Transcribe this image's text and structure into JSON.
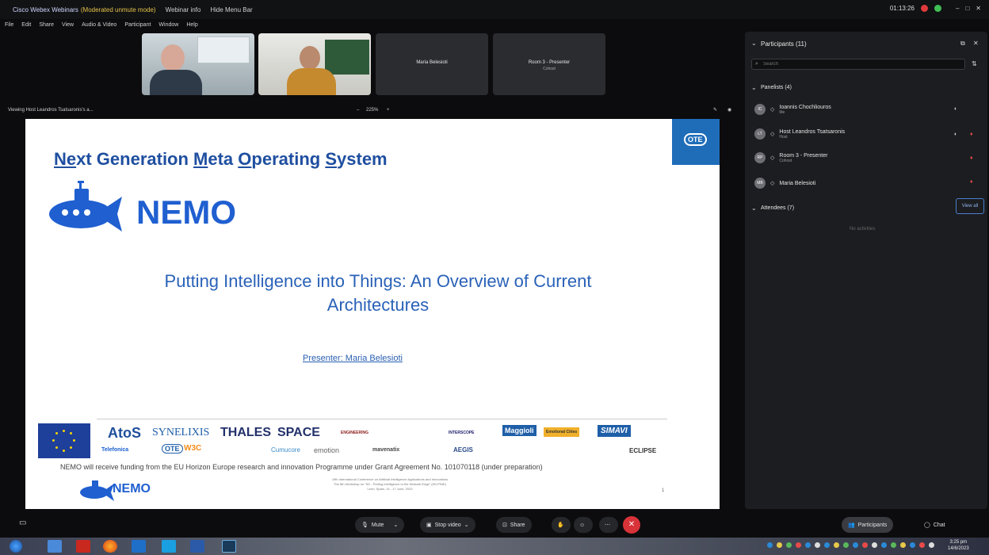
{
  "window": {
    "title": "Cisco Webex Webinars",
    "mode": "(Moderated unmute mode)",
    "webinar_info": "Webinar info",
    "hide_menu": "Hide Menu Bar",
    "timer": "01:13:26"
  },
  "menu": [
    "File",
    "Edit",
    "Share",
    "View",
    "Audio & Video",
    "Participant",
    "Window",
    "Help"
  ],
  "video_tiles": [
    {
      "name": "Maria Belesioti",
      "role": ""
    },
    {
      "name": "Room 3 - Presenter",
      "role": "Cohost"
    }
  ],
  "viewing": {
    "label": "Viewing Host Leandros Tsatsaronis's a...",
    "zoom": "225%"
  },
  "slide": {
    "heading_parts": [
      {
        "u": "Ne",
        "t": "xt Generation "
      },
      {
        "u": "M",
        "t": "eta "
      },
      {
        "u": "O",
        "t": "perating "
      },
      {
        "u": "S",
        "t": "ystem"
      }
    ],
    "nemo": "NEMO",
    "subtitle_line1": "Putting Intelligence into Things:  An Overview of Current",
    "subtitle_line2": "Architectures",
    "presenter": "Presenter: Maria Belesioti",
    "otc_logo": "OTE",
    "partners_row1": [
      "AtoS",
      "SYNELIXIS",
      "THALES",
      "SPACE",
      "ENGINEERING",
      "INTERSCOPE",
      "Maggioli",
      "Emotional Cities",
      "SIMAVI"
    ],
    "partners_row2": [
      "Telefonica",
      "OTE",
      "W3C",
      "Cumucore",
      "emotion",
      "mavenatix",
      "AEGIS",
      "ECLIPSE"
    ],
    "funding": "NEMO will receive funding from the EU Horizon Europe research and innovation Programme under Grant Agreement No. 101070118 (under preparation)",
    "conference_line1": "19th International Conference on Artificial Intelligence Applications and Innovations",
    "conference_line2": "The 8th Workshop on \"5G - Putting Intelligence to the Network Edge\" (5G-PINE)",
    "conference_line3": "León, Spain, 14 - 17 June, 2023",
    "nemo_small": "NEMO",
    "page_number": "1"
  },
  "panel": {
    "title": "Participants (11)",
    "search_placeholder": "Search",
    "panelists_header": "Panelists (4)",
    "panelists": [
      {
        "initials": "IC",
        "name": "Ioannis Chochliouros",
        "role": "Me"
      },
      {
        "initials": "LT",
        "name": "Host Leandros Tsatsaronis",
        "role": "Host"
      },
      {
        "initials": "RP",
        "name": "Room 3 - Presenter",
        "role": "Cohost"
      },
      {
        "initials": "MB",
        "name": "Maria Belesioti",
        "role": ""
      }
    ],
    "attendees_header": "Attendees (7)",
    "view_all": "View all",
    "no_activities": "No activities"
  },
  "controls": {
    "mute": "Mute",
    "stop_video": "Stop video",
    "share": "Share",
    "participants": "Participants",
    "chat": "Chat"
  },
  "clock": {
    "time": "3:25 pm",
    "date": "14/6/2023"
  },
  "colors": {
    "accent_blue": "#1f5fd0",
    "leave_red": "#d9333a",
    "panel_bg": "#1c1d20"
  }
}
